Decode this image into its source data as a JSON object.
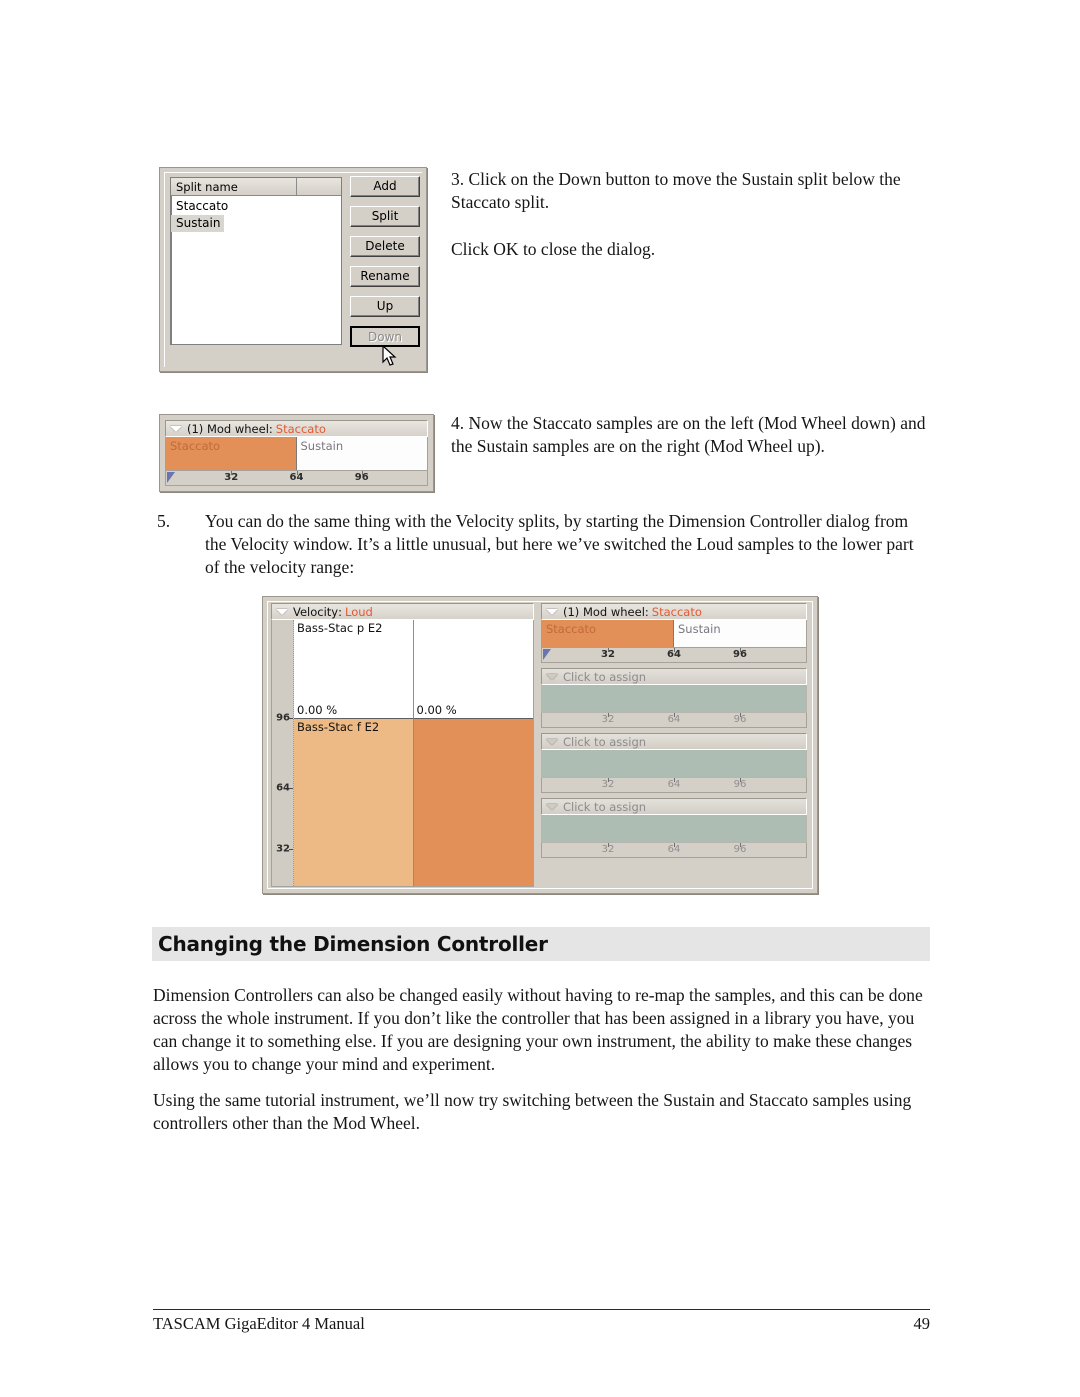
{
  "document": {
    "footer_left": "TASCAM GigaEditor 4 Manual",
    "footer_page": "49"
  },
  "step3": {
    "text1": "3. Click on the Down button to move the Sustain split below the Staccato split.",
    "text2": "Click OK to close the dialog."
  },
  "step4": {
    "text": "4. Now the Staccato samples are on the left (Mod Wheel down) and the Sustain samples are on the right (Mod Wheel up)."
  },
  "step5": {
    "number": "5.",
    "text": "You can do the same thing with the Velocity splits, by starting the Dimension Controller dialog from the Velocity window.  It’s a little unusual, but here we’ve switched the Loud samples to the lower part of the velocity range:"
  },
  "section": {
    "heading": "Changing the Dimension Controller",
    "para1": "Dimension Controllers can also be changed easily without having to re-map the samples, and this can be done across the whole instrument. If you don’t like the controller that has been assigned in a library you have, you can change it to something else.  If you are designing your own instrument, the ability to make these changes allows you to change your mind and experiment.",
    "para2": "Using the same tutorial instrument, we’ll now try switching between the Sustain and Staccato samples using controllers other than the Mod Wheel."
  },
  "split_dialog": {
    "column_header": "Split name",
    "rows": [
      {
        "label": "Staccato",
        "selected": false
      },
      {
        "label": "Sustain",
        "selected": true
      }
    ],
    "buttons": [
      {
        "label": "Add",
        "disabled": false
      },
      {
        "label": "Split",
        "disabled": false
      },
      {
        "label": "Delete",
        "disabled": false
      },
      {
        "label": "Rename",
        "disabled": false
      },
      {
        "label": "Up",
        "disabled": false
      },
      {
        "label": "Down",
        "disabled": true
      }
    ]
  },
  "modwheel_widget": {
    "title_prefix": "(1) Mod wheel",
    "title_separator": ":",
    "title_value": "Staccato",
    "zones": [
      {
        "label": "Staccato",
        "style": "orange"
      },
      {
        "label": "Sustain",
        "style": "white"
      }
    ],
    "ruler_labels": [
      "32",
      "64",
      "96"
    ]
  },
  "velocity_window": {
    "velocity_pane": {
      "title_prefix": "Velocity",
      "title_separator": ":",
      "title_value": "Loud",
      "axis_labels": [
        "96",
        "64",
        "32"
      ],
      "cells": [
        {
          "label": "Bass-Stac p E2",
          "percent": "0.00 %",
          "region": "upper-left"
        },
        {
          "label": "",
          "percent": "0.00 %",
          "region": "upper-right"
        },
        {
          "label": "Bass-Stac f E2",
          "percent": "",
          "region": "lower-left"
        },
        {
          "label": "",
          "percent": "",
          "region": "lower-right"
        }
      ]
    },
    "dimension_stack": [
      {
        "kind": "assigned",
        "title_prefix": "(1) Mod wheel",
        "title_separator": ":",
        "title_value": "Staccato",
        "zones": [
          {
            "label": "Staccato",
            "style": "orange"
          },
          {
            "label": "Sustain",
            "style": "white"
          }
        ],
        "ruler_labels": [
          "32",
          "64",
          "96"
        ]
      },
      {
        "kind": "unassigned",
        "title_prefix": "Click to assign",
        "title_separator": "",
        "title_value": "",
        "zones": [],
        "ruler_labels": [
          "32",
          "64",
          "96"
        ]
      },
      {
        "kind": "unassigned",
        "title_prefix": "Click to assign",
        "title_separator": "",
        "title_value": "",
        "zones": [],
        "ruler_labels": [
          "32",
          "64",
          "96"
        ]
      },
      {
        "kind": "unassigned",
        "title_prefix": "Click to assign",
        "title_separator": "",
        "title_value": "",
        "zones": [],
        "ruler_labels": [
          "32",
          "64",
          "96"
        ]
      }
    ]
  },
  "colors": {
    "accent_orange_text": "#e25a30",
    "zone_orange": "#e28f58",
    "cell_light_orange": "#edba85",
    "sage": "#aebdb4",
    "dialog_face": "#d4d0c8",
    "heading_band": "#e5e5e5"
  }
}
